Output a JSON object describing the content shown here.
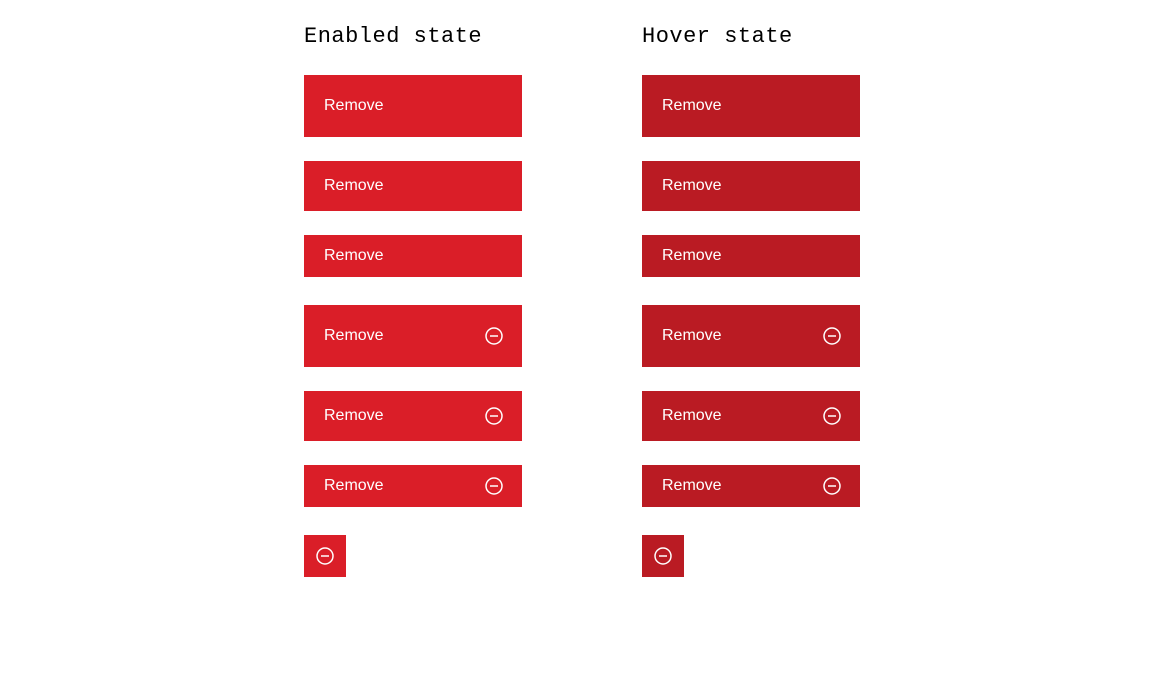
{
  "columns": {
    "enabled": {
      "heading": "Enabled state",
      "variant": "enabled"
    },
    "hover": {
      "heading": "Hover state",
      "variant": "hover"
    }
  },
  "buttons": {
    "label": "Remove",
    "icon_name": "subtract-icon"
  },
  "colors": {
    "enabled": "#da1e28",
    "hover": "#ba1b23"
  }
}
